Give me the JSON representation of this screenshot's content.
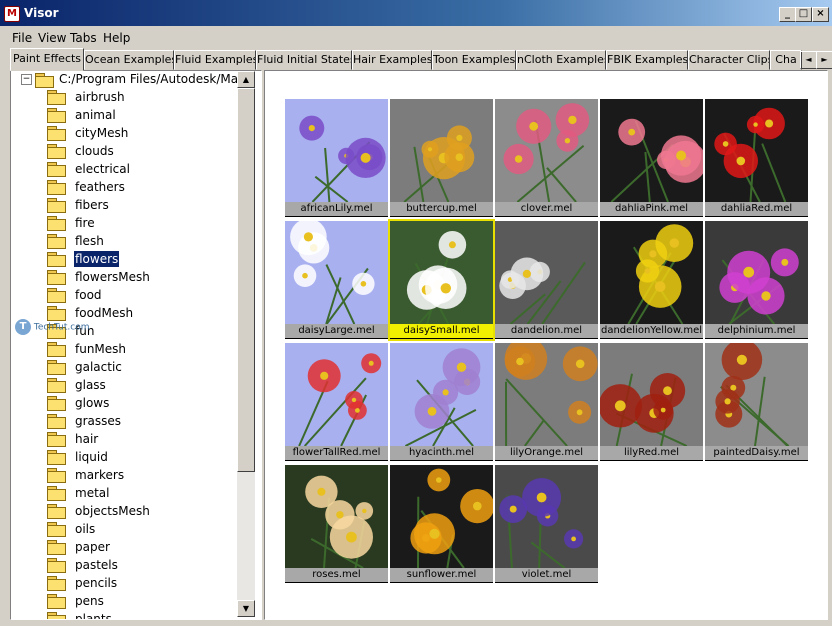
{
  "window": {
    "title": "Visor",
    "app_icon": "maya-icon",
    "controls": [
      "_",
      "□",
      "×"
    ]
  },
  "menu": [
    "File",
    "View",
    "Tabs",
    "Help"
  ],
  "tabs": [
    "Paint Effects",
    "Ocean Examples",
    "Fluid Examples",
    "Fluid Initial States",
    "Hair Examples",
    "Toon Examples",
    "nCloth Examples",
    "FBIK Examples",
    "Character Clips",
    "Cha"
  ],
  "active_tab": 0,
  "tab_scroll": [
    "◄",
    "►"
  ],
  "tree": {
    "expander": "−",
    "root": "C:/Program Files/Autodesk/Ma",
    "items": [
      "airbrush",
      "animal",
      "cityMesh",
      "clouds",
      "electrical",
      "feathers",
      "fibers",
      "fire",
      "flesh",
      "flowers",
      "flowersMesh",
      "food",
      "foodMesh",
      "fun",
      "funMesh",
      "galactic",
      "glass",
      "glows",
      "grasses",
      "hair",
      "liquid",
      "markers",
      "metal",
      "objectsMesh",
      "oils",
      "paper",
      "pastels",
      "pencils",
      "pens",
      "plants"
    ],
    "selected": "flowers"
  },
  "scroll_arrows": {
    "up": "▲",
    "down": "▼"
  },
  "watermark": {
    "icon": "T",
    "text": "TechTut.com"
  },
  "thumbnails": [
    {
      "label": "africanLily.mel",
      "bg": "#a8b0f0",
      "flower": "#7a4cc8"
    },
    {
      "label": "buttercup.mel",
      "bg": "#7c7c7c",
      "flower": "#e0a020"
    },
    {
      "label": "clover.mel",
      "bg": "#8c8c8c",
      "flower": "#e05a80"
    },
    {
      "label": "dahliaPink.mel",
      "bg": "#1a1a1a",
      "flower": "#f07890"
    },
    {
      "label": "dahliaRed.mel",
      "bg": "#1a1a1a",
      "flower": "#e01818"
    },
    {
      "label": "daisyLarge.mel",
      "bg": "#a8b0f0",
      "flower": "#ffffff"
    },
    {
      "label": "daisySmall.mel",
      "bg": "#3a5a30",
      "flower": "#ffffff"
    },
    {
      "label": "dandelion.mel",
      "bg": "#5a5a5a",
      "flower": "#e8e8e8"
    },
    {
      "label": "dandelionYellow.mel",
      "bg": "#1a1a1a",
      "flower": "#f0d010"
    },
    {
      "label": "delphinium.mel",
      "bg": "#3a3a3a",
      "flower": "#d040d0"
    },
    {
      "label": "flowerTallRed.mel",
      "bg": "#a8b0f0",
      "flower": "#e03030"
    },
    {
      "label": "hyacinth.mel",
      "bg": "#a8b0f0",
      "flower": "#a080d0"
    },
    {
      "label": "lilyOrange.mel",
      "bg": "#7c7c7c",
      "flower": "#d08020"
    },
    {
      "label": "lilyRed.mel",
      "bg": "#7c7c7c",
      "flower": "#a02010"
    },
    {
      "label": "paintedDaisy.mel",
      "bg": "#8c8c8c",
      "flower": "#a03018"
    },
    {
      "label": "roses.mel",
      "bg": "#2a3a20",
      "flower": "#f8d8a0"
    },
    {
      "label": "sunflower.mel",
      "bg": "#1a1a1a",
      "flower": "#f0a010"
    },
    {
      "label": "violet.mel",
      "bg": "#4a4a4a",
      "flower": "#5838b0"
    }
  ],
  "selected_thumbnail": "daisySmall.mel"
}
